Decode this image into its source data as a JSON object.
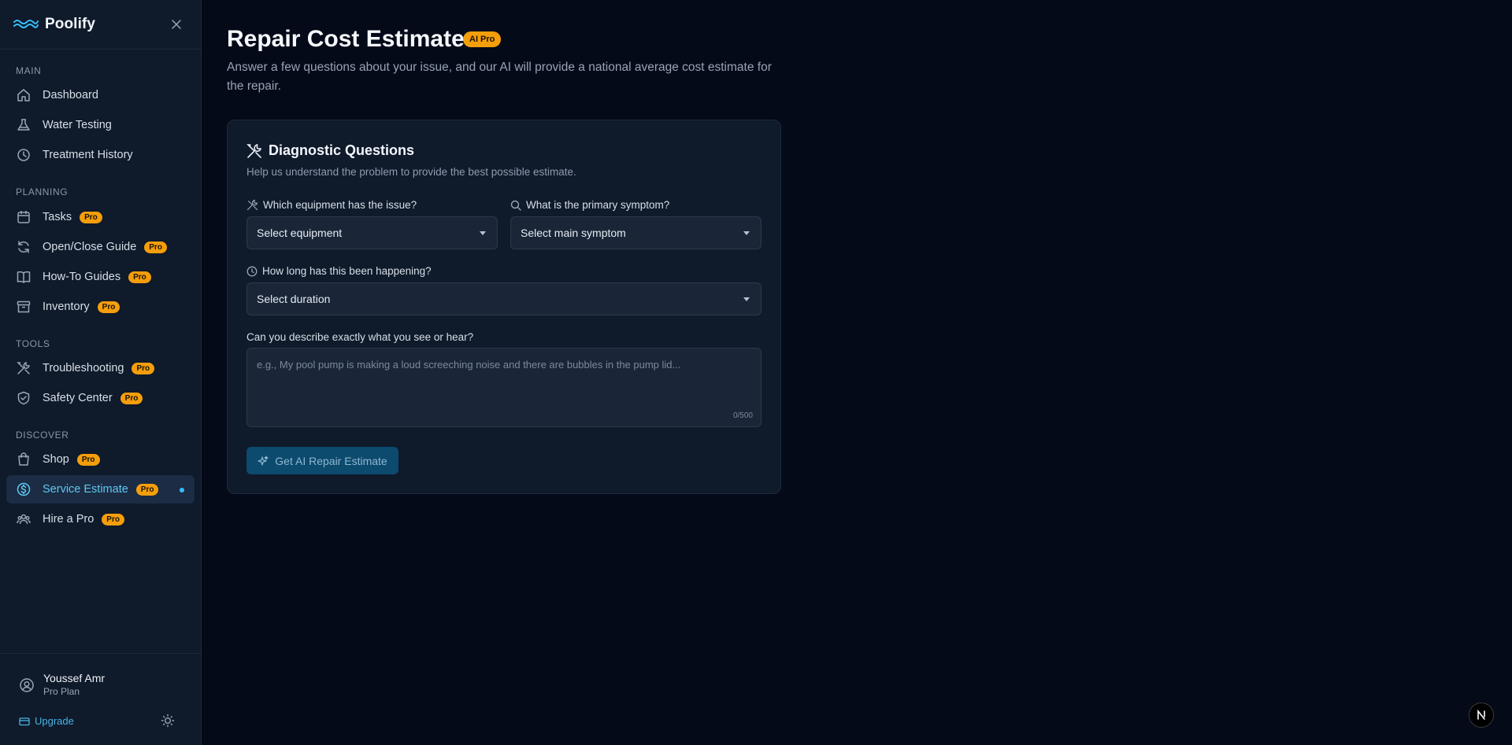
{
  "brand": {
    "name": "Poolify"
  },
  "sidebar": {
    "sections": [
      {
        "label": "MAIN",
        "items": [
          {
            "label": "Dashboard",
            "icon": "home-icon",
            "pro": false
          },
          {
            "label": "Water Testing",
            "icon": "flask-icon",
            "pro": false
          },
          {
            "label": "Treatment History",
            "icon": "clock-icon",
            "pro": false
          }
        ]
      },
      {
        "label": "PLANNING",
        "items": [
          {
            "label": "Tasks",
            "icon": "calendar-icon",
            "pro": true
          },
          {
            "label": "Open/Close Guide",
            "icon": "refresh-icon",
            "pro": true
          },
          {
            "label": "How-To Guides",
            "icon": "book-icon",
            "pro": true
          },
          {
            "label": "Inventory",
            "icon": "archive-icon",
            "pro": true
          }
        ]
      },
      {
        "label": "TOOLS",
        "items": [
          {
            "label": "Troubleshooting",
            "icon": "tools-icon",
            "pro": true
          },
          {
            "label": "Safety Center",
            "icon": "shield-check-icon",
            "pro": true
          }
        ]
      },
      {
        "label": "DISCOVER",
        "items": [
          {
            "label": "Shop",
            "icon": "shopping-bag-icon",
            "pro": true
          },
          {
            "label": "Service Estimate",
            "icon": "dollar-circle-icon",
            "pro": true,
            "active": true
          },
          {
            "label": "Hire a Pro",
            "icon": "users-icon",
            "pro": true
          }
        ]
      }
    ],
    "pro_badge": "Pro",
    "user": {
      "name": "Youssef Amr",
      "plan": "Pro Plan"
    },
    "upgrade_label": "Upgrade"
  },
  "main": {
    "title": "Repair Cost Estimate",
    "title_badge": "AI Pro",
    "description": "Answer a few questions about your issue, and our AI will provide a national average cost estimate for the repair.",
    "card": {
      "title": "Diagnostic Questions",
      "subtitle": "Help us understand the problem to provide the best possible estimate.",
      "equipment_label": "Which equipment has the issue?",
      "equipment_value": "Select equipment",
      "symptom_label": "What is the primary symptom?",
      "symptom_value": "Select main symptom",
      "duration_label": "How long has this been happening?",
      "duration_value": "Select duration",
      "describe_label": "Can you describe exactly what you see or hear?",
      "describe_placeholder": "e.g., My pool pump is making a loud screeching noise and there are bubbles in the pump lid...",
      "describe_counter": "0/500",
      "submit_label": "Get AI Repair Estimate"
    }
  },
  "colors": {
    "background": "#050a18",
    "sidebar": "#0f1a2b",
    "accent": "#38bdf8",
    "badge": "#f59e0b",
    "button": "#0c4a6e"
  }
}
